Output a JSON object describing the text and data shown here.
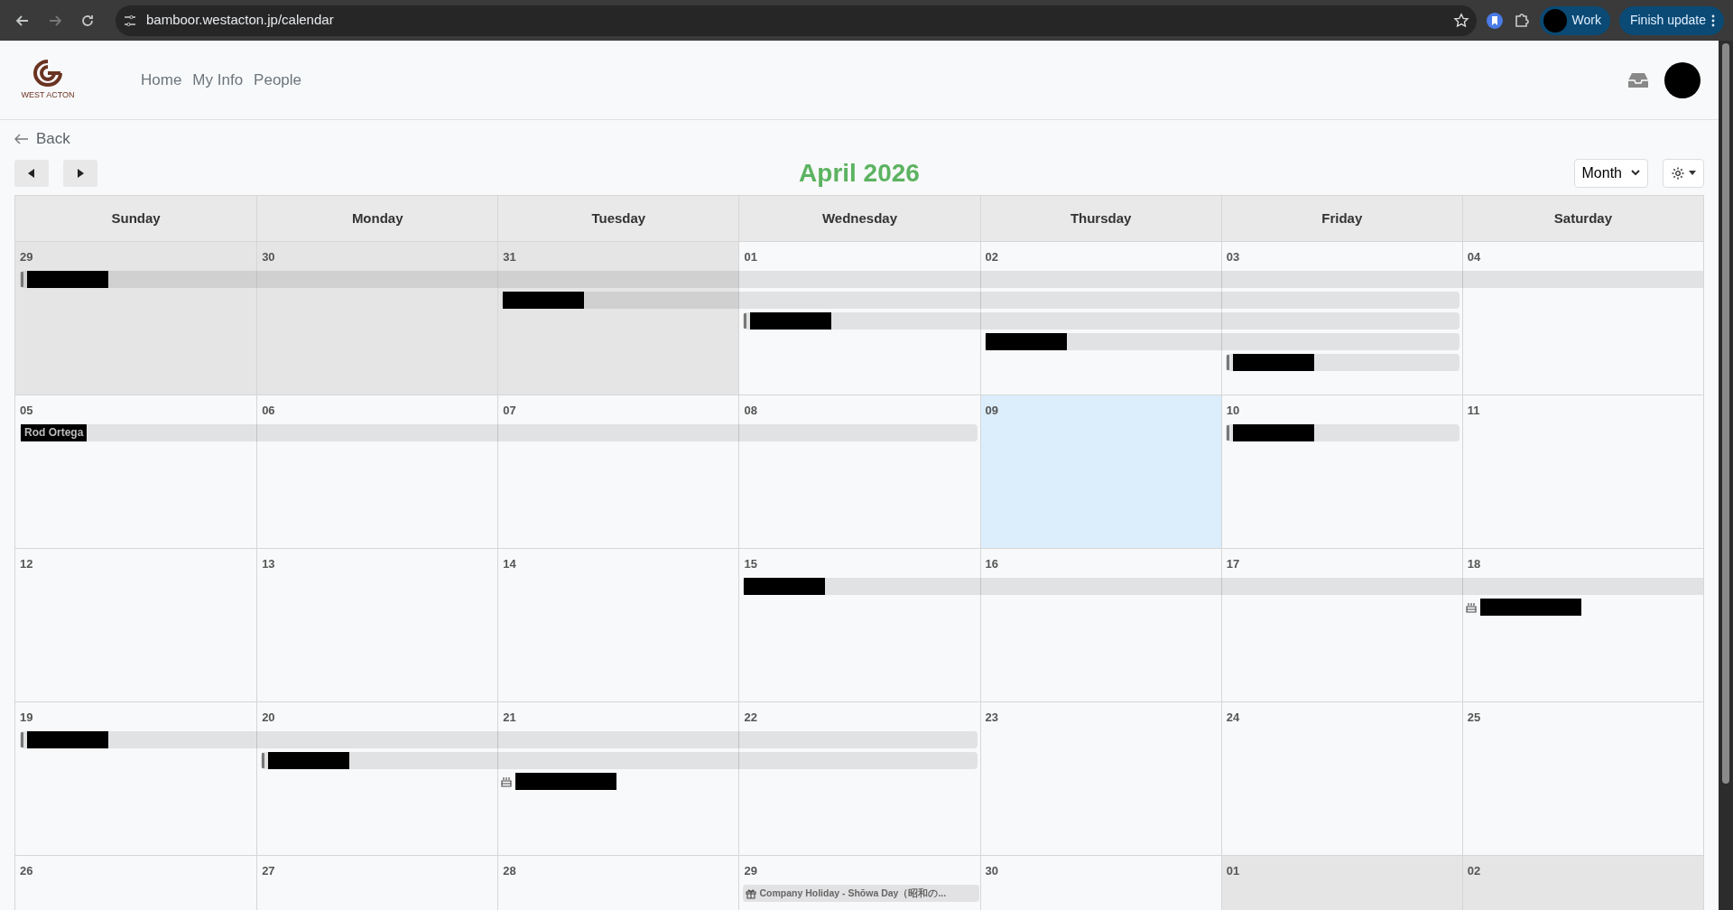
{
  "browser": {
    "url": "bamboor.westacton.jp/calendar",
    "profile": "Work",
    "update_button": "Finish update"
  },
  "header": {
    "logo_text": "WEST ACTON",
    "nav": [
      {
        "label": "Home"
      },
      {
        "label": "My Info"
      },
      {
        "label": "People"
      }
    ]
  },
  "back": "Back",
  "toolbar": {
    "title": "April 2026",
    "view": "Month"
  },
  "weekdays": [
    "Sunday",
    "Monday",
    "Tuesday",
    "Wednesday",
    "Thursday",
    "Friday",
    "Saturday"
  ],
  "weeks": [
    {
      "days": [
        {
          "label": "29",
          "other_month": true,
          "today": false,
          "slots": [
            {
              "kind": "timeoff"
            }
          ]
        },
        {
          "label": "30",
          "other_month": true,
          "today": false,
          "slots": [
            {
              "kind": "continuation"
            }
          ]
        },
        {
          "label": "31",
          "other_month": true,
          "today": false,
          "slots": [
            {
              "kind": "continuation"
            },
            {
              "kind": "plain"
            }
          ]
        },
        {
          "label": "01",
          "other_month": false,
          "today": false,
          "slots": [
            {
              "kind": "continuation"
            },
            {
              "kind": "continuation"
            },
            {
              "kind": "timeoff"
            }
          ]
        },
        {
          "label": "02",
          "other_month": false,
          "today": false,
          "slots": [
            {
              "kind": "continuation"
            },
            {
              "kind": "continuation"
            },
            {
              "kind": "continuation"
            },
            {
              "kind": "plain"
            }
          ]
        },
        {
          "label": "03",
          "other_month": false,
          "today": false,
          "slots": [
            {
              "kind": "continuation"
            },
            {
              "kind": "continuation"
            },
            {
              "kind": "continuation"
            },
            {
              "kind": "continuation"
            },
            {
              "kind": "timeoff"
            }
          ]
        },
        {
          "label": "04",
          "other_month": false,
          "today": false,
          "slots": [
            {
              "kind": "continuation"
            }
          ]
        }
      ]
    },
    {
      "days": [
        {
          "label": "05",
          "other_month": false,
          "today": false,
          "slots": [
            {
              "kind": "plain",
              "title": "Rod Ortega"
            }
          ]
        },
        {
          "label": "06",
          "other_month": false,
          "today": false,
          "slots": [
            {
              "kind": "continuation"
            }
          ]
        },
        {
          "label": "07",
          "other_month": false,
          "today": false,
          "slots": [
            {
              "kind": "continuation"
            }
          ]
        },
        {
          "label": "08",
          "other_month": false,
          "today": false,
          "slots": [
            {
              "kind": "continuation"
            }
          ]
        },
        {
          "label": "09",
          "other_month": false,
          "today": true
        },
        {
          "label": "10",
          "other_month": false,
          "today": false,
          "slots": [
            {
              "kind": "timeoff"
            }
          ]
        },
        {
          "label": "11",
          "other_month": false,
          "today": false
        }
      ]
    },
    {
      "days": [
        {
          "label": "12",
          "other_month": false,
          "today": false
        },
        {
          "label": "13",
          "other_month": false,
          "today": false
        },
        {
          "label": "14",
          "other_month": false,
          "today": false
        },
        {
          "label": "15",
          "other_month": false,
          "today": false,
          "slots": [
            {
              "kind": "plain"
            }
          ]
        },
        {
          "label": "16",
          "other_month": false,
          "today": false,
          "slots": [
            {
              "kind": "continuation"
            }
          ]
        },
        {
          "label": "17",
          "other_month": false,
          "today": false,
          "slots": [
            {
              "kind": "continuation"
            }
          ]
        },
        {
          "label": "18",
          "other_month": false,
          "today": false,
          "slots": [
            {
              "kind": "continuation"
            },
            {
              "kind": "birthday"
            }
          ]
        }
      ]
    },
    {
      "days": [
        {
          "label": "19",
          "other_month": false,
          "today": false,
          "slots": [
            {
              "kind": "timeoff"
            }
          ]
        },
        {
          "label": "20",
          "other_month": false,
          "today": false,
          "slots": [
            {
              "kind": "continuation"
            },
            {
              "kind": "timeoff"
            }
          ]
        },
        {
          "label": "21",
          "other_month": false,
          "today": false,
          "slots": [
            {
              "kind": "continuation"
            },
            {
              "kind": "continuation"
            },
            {
              "kind": "birthday"
            }
          ]
        },
        {
          "label": "22",
          "other_month": false,
          "today": false,
          "slots": [
            {
              "kind": "continuation"
            },
            {
              "kind": "continuation"
            }
          ]
        },
        {
          "label": "23",
          "other_month": false,
          "today": false
        },
        {
          "label": "24",
          "other_month": false,
          "today": false
        },
        {
          "label": "25",
          "other_month": false,
          "today": false
        }
      ]
    },
    {
      "days": [
        {
          "label": "26",
          "other_month": false,
          "today": false
        },
        {
          "label": "27",
          "other_month": false,
          "today": false
        },
        {
          "label": "28",
          "other_month": false,
          "today": false
        },
        {
          "label": "29",
          "other_month": false,
          "today": false,
          "slots": [
            {
              "kind": "holiday",
              "title": "Company Holiday - Shōwa Day（昭和の..."
            }
          ]
        },
        {
          "label": "30",
          "other_month": false,
          "today": false
        },
        {
          "label": "01",
          "other_month": true,
          "today": false
        },
        {
          "label": "02",
          "other_month": true,
          "today": false
        }
      ]
    }
  ]
}
